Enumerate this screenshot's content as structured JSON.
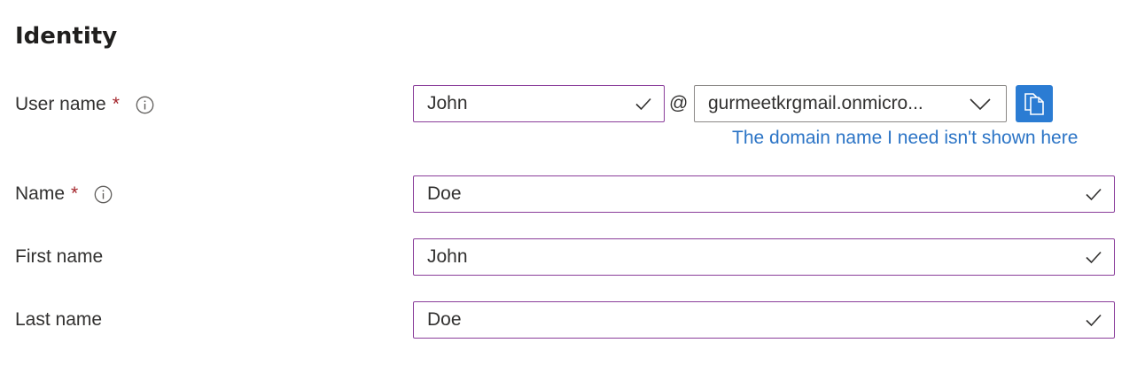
{
  "section": {
    "title": "Identity"
  },
  "user_name": {
    "label": "User name",
    "required_marker": "*",
    "info_icon": "info-icon",
    "value": "John",
    "at": "@",
    "domain_value": "gurmeetkrgmail.onmicro...",
    "copy_icon": "copy-icon",
    "domain_link": "The domain name I need isn't shown here"
  },
  "name": {
    "label": "Name",
    "required_marker": "*",
    "info_icon": "info-icon",
    "value": "Doe"
  },
  "first_name": {
    "label": "First name",
    "value": "John"
  },
  "last_name": {
    "label": "Last name",
    "value": "Doe"
  },
  "colors": {
    "accent": "#2b7cd3",
    "link": "#2b74c6",
    "required": "#a4262c",
    "valid_border": "#8a3d9a"
  }
}
